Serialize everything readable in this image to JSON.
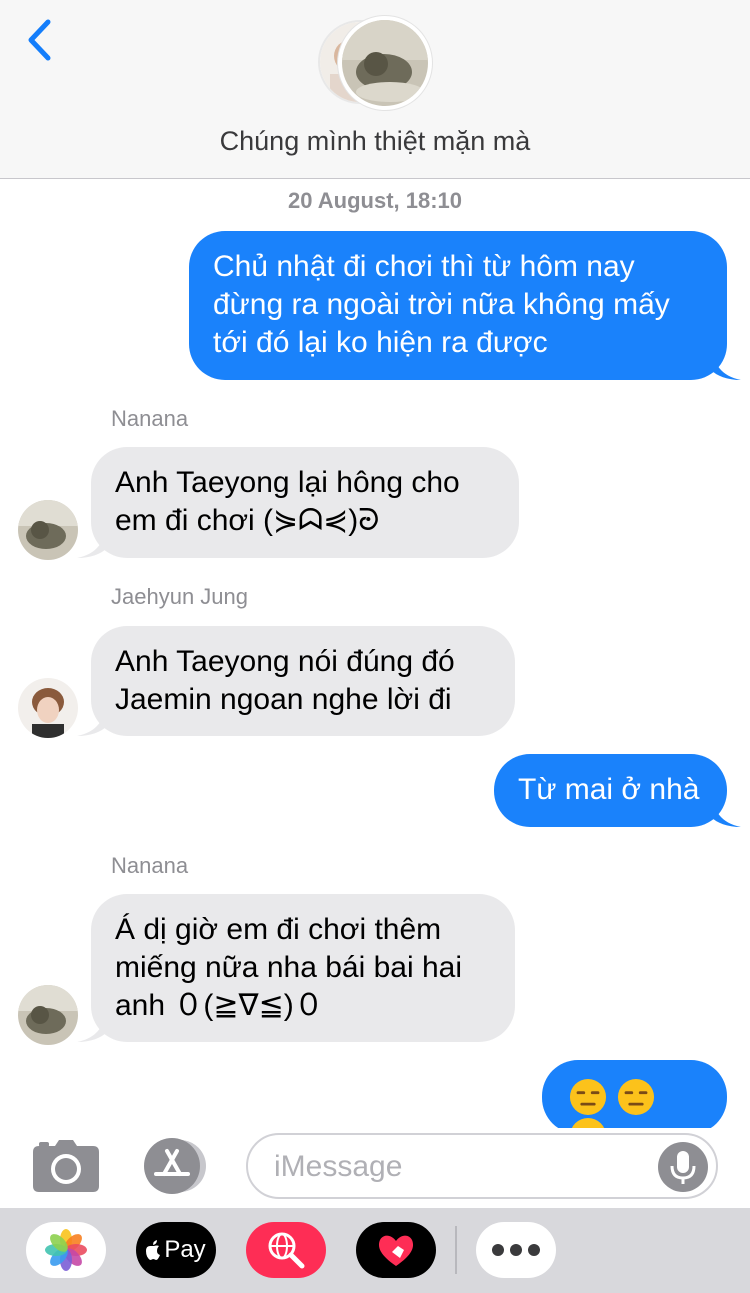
{
  "header": {
    "back_label": "Back",
    "chat_title": "Chúng mình thiệt mặn mà"
  },
  "timestamp": "20 August, 18:10",
  "messages": [
    {
      "direction": "outgoing",
      "lines": [
        "Chủ nhật đi chơi thì từ hôm nay",
        "đừng ra ngoài trời nữa không mấy",
        "tới đó lại ko hiện ra được"
      ]
    },
    {
      "direction": "incoming",
      "sender": "Nanana",
      "lines": [
        "Anh Taeyong lại hông cho",
        "em đi chơi (⋟ᗣ⋞)ᘒ"
      ]
    },
    {
      "direction": "incoming",
      "sender": "Jaehyun Jung",
      "lines": [
        "Anh Taeyong nói đúng đó",
        "Jaemin ngoan nghe lời đi"
      ]
    },
    {
      "direction": "outgoing",
      "lines": [
        "Từ mai ở nhà"
      ]
    },
    {
      "direction": "incoming",
      "sender": "Nanana",
      "lines": [
        "Á dị giờ em đi chơi thêm",
        "miếng nữa nha bái bai hai",
        "anh ０(≧∇≦)０"
      ]
    },
    {
      "direction": "outgoing",
      "emoji": [
        "expressionless-face",
        "expressionless-face",
        "expressionless-face"
      ]
    }
  ],
  "compose": {
    "placeholder": "iMessage"
  },
  "tray": {
    "apple_pay_label": "Pay",
    "items": [
      "photos-app",
      "apple-pay",
      "image-search",
      "digital-touch",
      "more"
    ]
  },
  "colors": {
    "outgoing_bubble": "#1a82fb",
    "incoming_bubble": "#e9e9eb",
    "accent": "#147efb"
  }
}
